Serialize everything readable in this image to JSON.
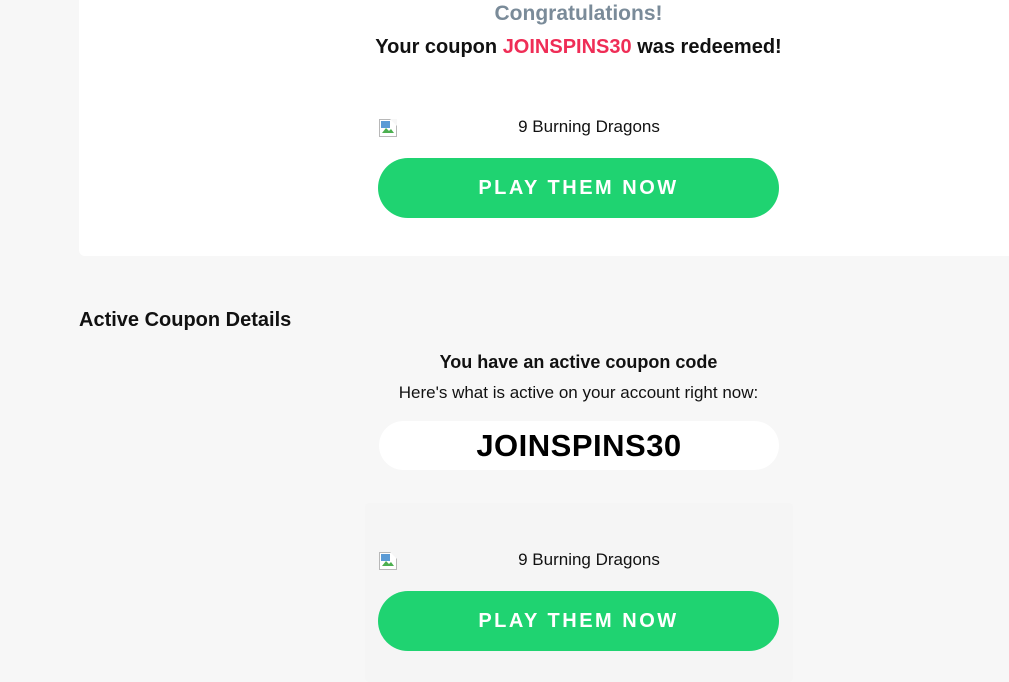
{
  "redeem": {
    "title": "Congratulations!",
    "message_prefix": "Your coupon ",
    "coupon_code": "JOINSPINS30",
    "message_suffix": " was redeemed!",
    "game_name": "9 Burning Dragons",
    "play_label": "PLAY THEM NOW"
  },
  "active": {
    "section_title": "Active Coupon Details",
    "heading": "You have an active coupon code",
    "subheading": "Here's what is active on your account right now:",
    "coupon_code": "JOINSPINS30",
    "game_name": "9 Burning Dragons",
    "play_label": "PLAY THEM NOW"
  },
  "colors": {
    "background": "#f7f7f7",
    "card": "#ffffff",
    "accent_green": "#1fd371",
    "coupon_red": "#ef2d56",
    "title_gray": "#7a8b99"
  },
  "icons": {
    "game_thumbnail": "broken-image-icon"
  }
}
